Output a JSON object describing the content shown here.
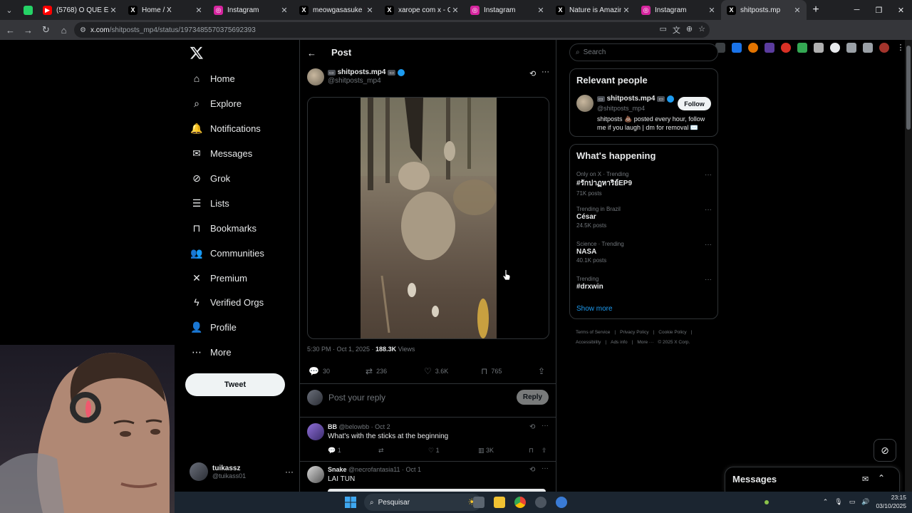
{
  "browser": {
    "tabs": [
      {
        "title": "(5768) O QUE É ME",
        "fav_color": "#ff0000",
        "fav_glyph": "▶"
      },
      {
        "title": "Home / X",
        "fav_color": "#000000",
        "fav_glyph": "X"
      },
      {
        "title": "Instagram",
        "fav_color": "#d6249f",
        "fav_glyph": "◎"
      },
      {
        "title": "meowgasasuke 💗",
        "fav_color": "#000000",
        "fav_glyph": "X"
      },
      {
        "title": "xarope com x - Curi",
        "fav_color": "#000000",
        "fav_glyph": "X"
      },
      {
        "title": "Instagram",
        "fav_color": "#d6249f",
        "fav_glyph": "◎"
      },
      {
        "title": "Nature is Amazing 🌿",
        "fav_color": "#000000",
        "fav_glyph": "X"
      },
      {
        "title": "Instagram",
        "fav_color": "#d6249f",
        "fav_glyph": "◎"
      },
      {
        "title": "shitposts.mp",
        "fav_color": "#000000",
        "fav_glyph": "X",
        "active": true
      }
    ],
    "url_host": "x.com",
    "url_path": "/shitposts_mp4/status/1973485570375692393"
  },
  "nav": {
    "items": [
      {
        "label": "Home",
        "icon": "home-icon"
      },
      {
        "label": "Explore",
        "icon": "search-icon"
      },
      {
        "label": "Notifications",
        "icon": "bell-icon"
      },
      {
        "label": "Messages",
        "icon": "envelope-icon"
      },
      {
        "label": "Grok",
        "icon": "grok-icon"
      },
      {
        "label": "Lists",
        "icon": "list-icon"
      },
      {
        "label": "Bookmarks",
        "icon": "bookmark-icon"
      },
      {
        "label": "Communities",
        "icon": "people-icon"
      },
      {
        "label": "Premium",
        "icon": "x-icon"
      },
      {
        "label": "Verified Orgs",
        "icon": "lightning-icon"
      },
      {
        "label": "Profile",
        "icon": "person-icon"
      },
      {
        "label": "More",
        "icon": "more-circle-icon"
      }
    ],
    "tweet_label": "Tweet",
    "account": {
      "name": "tuikassz",
      "handle": "@tuikass01"
    }
  },
  "post": {
    "header_title": "Post",
    "author_name": "shitposts.mp4",
    "author_handle": "@shitposts_mp4",
    "timestamp": "5:30 PM · Oct 1, 2025 · ",
    "views_count": "188.3K",
    "views_label": " Views",
    "stats": {
      "replies": "30",
      "reposts": "236",
      "likes": "3.6K",
      "bookmarks": "765"
    },
    "reply_placeholder": "Post your reply",
    "reply_button": "Reply"
  },
  "comments": [
    {
      "name": "BB",
      "meta": "@belowbb · Oct 2",
      "text": "What's with the sticks at the beginning",
      "replies": "1",
      "reposts": "",
      "likes": "1",
      "views": "3K"
    },
    {
      "name": "Snake",
      "meta": "@necrofantasia11 · Oct 1",
      "text": "LAI TUN"
    }
  ],
  "sidebar": {
    "search_placeholder": "Search",
    "relevant_title": "Relevant people",
    "relevant": {
      "name": "shitposts.mp4",
      "handle": "@shitposts_mp4",
      "bio": "shitposts 💩 posted every hour, follow me if you laugh | dm for removal ✉️",
      "follow_label": "Follow"
    },
    "happening_title": "What's happening",
    "trends": [
      {
        "context": "Only on X · Trending",
        "name": "#รักปาฏหาริย์EP9",
        "count": "71K posts"
      },
      {
        "context": "Trending in Brazil",
        "name": "César",
        "count": "24.5K posts"
      },
      {
        "context": "Science · Trending",
        "name": "NASA",
        "count": "40.1K posts"
      },
      {
        "context": "Trending",
        "name": "#drxwin",
        "count": ""
      }
    ],
    "show_more": "Show more",
    "footer": [
      "Terms of Service",
      "|",
      "Privacy Policy",
      "|",
      "Cookie Policy",
      "|",
      "Accessibility",
      "|",
      "Ads info",
      "|",
      "More ···",
      "© 2025 X Corp."
    ]
  },
  "messages_drawer": {
    "title": "Messages"
  },
  "taskbar": {
    "search_label": "Pesquisar",
    "time": "23:15",
    "date": "03/10/2025"
  }
}
